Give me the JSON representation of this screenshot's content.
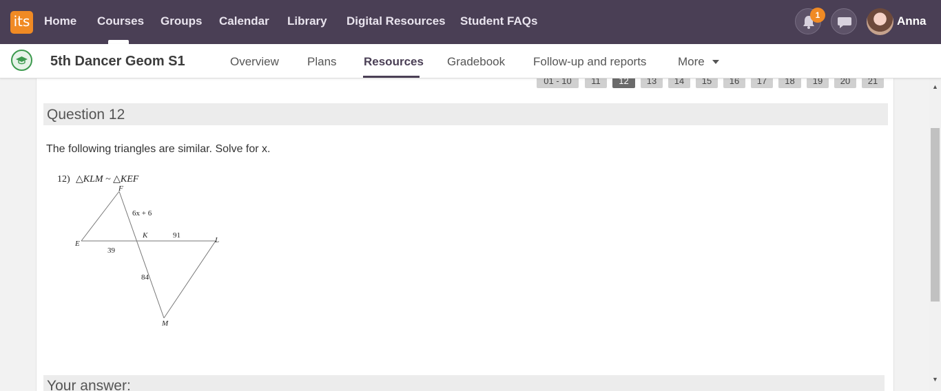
{
  "topbar": {
    "logo_text": "its",
    "nav": [
      "Home",
      "Courses",
      "Groups",
      "Calendar",
      "Library",
      "Digital Resources",
      "Student FAQs"
    ],
    "active_nav": "Courses",
    "notification_count": "1",
    "username": "Anna",
    "colors": {
      "bar": "#4a3f55",
      "accent": "#f08a24"
    }
  },
  "subbar": {
    "course_title": "5th Dancer Geom S1",
    "tabs": [
      "Overview",
      "Plans",
      "Resources",
      "Gradebook",
      "Follow-up and reports",
      "More"
    ],
    "active_tab": "Resources"
  },
  "pager": {
    "items": [
      "01 - 10",
      "11",
      "12",
      "13",
      "14",
      "15",
      "16",
      "17",
      "18",
      "19",
      "20",
      "21"
    ],
    "active": "12"
  },
  "question": {
    "title": "Question 12",
    "text": "The following triangles are similar. Solve for x.",
    "figure": {
      "label": "12)",
      "similarity": "△KLM ~ △KEF",
      "vertices": [
        "F",
        "E",
        "K",
        "L",
        "M"
      ],
      "segments": [
        "6x + 6",
        "91",
        "39",
        "84"
      ]
    }
  },
  "answer": {
    "title": "Your answer:"
  }
}
